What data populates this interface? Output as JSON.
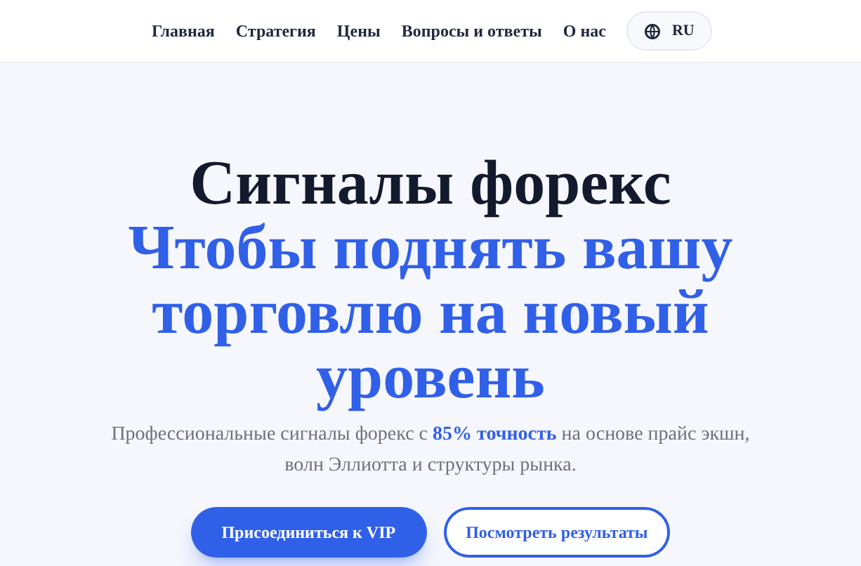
{
  "nav": {
    "items": [
      {
        "label": "Главная"
      },
      {
        "label": "Стратегия"
      },
      {
        "label": "Цены"
      },
      {
        "label": "Вопросы и ответы"
      },
      {
        "label": "О нас"
      }
    ],
    "language": "RU"
  },
  "hero": {
    "title": "Сигналы форекс",
    "tagline": "Чтобы поднять вашу торговлю на новый уровень",
    "description": "Профессиональные сигналы форекс с **85% точность** на основе прайс экшн, волн Эллиотта и структуры рынка.",
    "buttons": [
      {
        "label": "Присоединиться к VIP",
        "kind": "primary"
      },
      {
        "label": "Посмотреть результаты",
        "kind": "outline"
      }
    ]
  }
}
